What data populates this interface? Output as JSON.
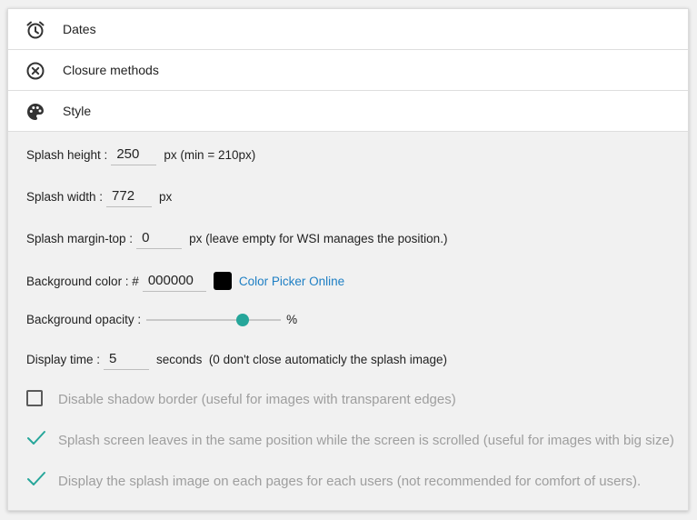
{
  "sections": {
    "dates": {
      "label": "Dates",
      "icon": "alarm-clock-icon"
    },
    "closure": {
      "label": "Closure methods",
      "icon": "close-circle-icon"
    },
    "style": {
      "label": "Style",
      "icon": "palette-icon"
    }
  },
  "style": {
    "splash_height": {
      "label": "Splash height :",
      "value": "250",
      "suffix": "px (min = 210px)"
    },
    "splash_width": {
      "label": "Splash width :",
      "value": "772",
      "suffix": "px"
    },
    "margin_top": {
      "label": "Splash margin-top :",
      "value": "0",
      "suffix": "px (leave empty for WSI manages the position.)"
    },
    "bg_color": {
      "label": "Background color : #",
      "value": "000000",
      "swatch_color": "#000000",
      "link": "Color Picker Online"
    },
    "bg_opacity": {
      "label": "Background opacity :",
      "suffix": "%",
      "level_fraction": 0.74
    },
    "display_time": {
      "label": "Display time :",
      "value": "5",
      "suffix": "seconds  (0 don't close automaticly the splash image)"
    },
    "checkboxes": [
      {
        "label": "Disable shadow border (useful for images with transparent edges)",
        "checked": false
      },
      {
        "label": "Splash screen leaves in the same position while the screen is scrolled (useful for images with big size)",
        "checked": true
      },
      {
        "label": "Display the splash image on each pages for each users (not recommended for comfort of users).",
        "checked": true
      }
    ]
  },
  "colors": {
    "accent": "#26a69a",
    "link": "#1e7fc4",
    "muted_text": "#9e9e9e"
  }
}
